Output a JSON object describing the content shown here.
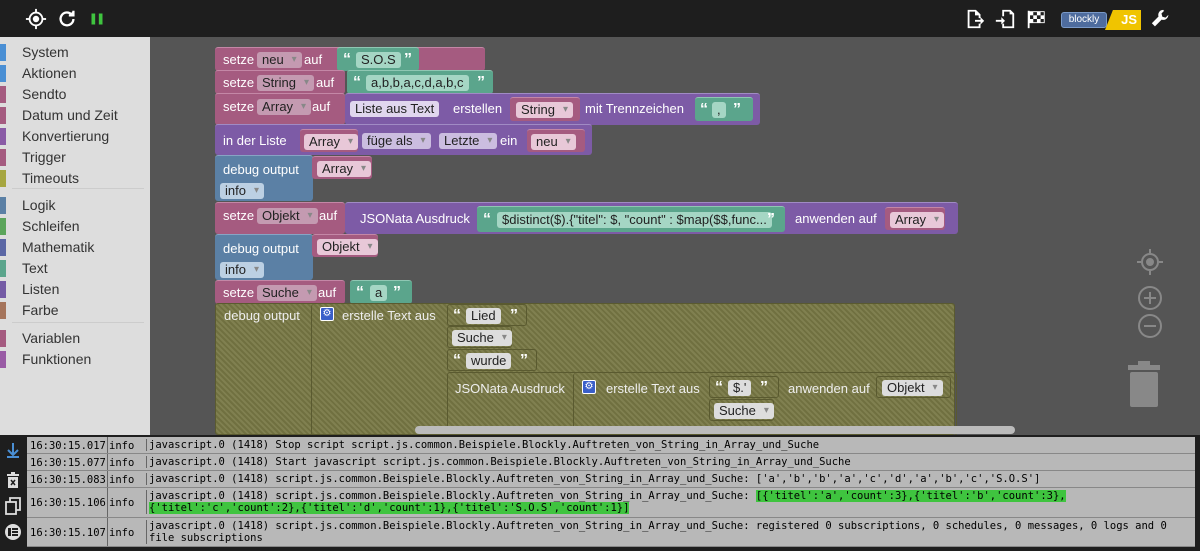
{
  "toolbar": {
    "icons": [
      "target-icon",
      "reload-icon",
      "pause-icon",
      "export-icon",
      "import-icon",
      "flag-icon",
      "wrench-icon"
    ],
    "blockly_label": "blockly",
    "js_label": "JS"
  },
  "toolbox": {
    "categories": [
      {
        "label": "System",
        "color": "#4a8fd4"
      },
      {
        "label": "Aktionen",
        "color": "#4a8fd4"
      },
      {
        "label": "Sendto",
        "color": "#a55b80"
      },
      {
        "label": "Datum und Zeit",
        "color": "#a55b80"
      },
      {
        "label": "Konvertierung",
        "color": "#8a5ba6"
      },
      {
        "label": "Trigger",
        "color": "#a55b80"
      },
      {
        "label": "Timeouts",
        "color": "#a6a640"
      },
      {
        "label": "Logik",
        "color": "#5b80a5"
      },
      {
        "label": "Schleifen",
        "color": "#5ba55b"
      },
      {
        "label": "Mathematik",
        "color": "#5b67a5"
      },
      {
        "label": "Text",
        "color": "#5ba58c"
      },
      {
        "label": "Listen",
        "color": "#745ba5"
      },
      {
        "label": "Farbe",
        "color": "#a5745b"
      },
      {
        "label": "Variablen",
        "color": "#a55b80"
      },
      {
        "label": "Funktionen",
        "color": "#995ba5"
      }
    ]
  },
  "blocks": {
    "setze": "setze",
    "auf": "auf",
    "b1": {
      "var": "neu",
      "text": "S.O.S"
    },
    "b2": {
      "var": "String",
      "text": "a,b,b,a,c,d,a,b,c"
    },
    "b3": {
      "var": "Array",
      "liste": "Liste aus Text",
      "erstellen": "erstellen",
      "src": "String",
      "mit": "mit Trennzeichen",
      "sep": ","
    },
    "b4": {
      "in": "in der Liste",
      "list": "Array",
      "mode": "füge als",
      "pos": "Letzte",
      "ein": "ein",
      "item": "neu"
    },
    "b5": {
      "debug": "debug output",
      "var": "Array",
      "level": "info"
    },
    "b6": {
      "var": "Objekt",
      "jsonata": "JSONata Ausdruck",
      "expr": "$distinct($).{\"titel\": $, \"count\" : $map($$,func...",
      "anwenden": "anwenden auf",
      "target": "Array"
    },
    "b7": {
      "debug": "debug output",
      "var": "Objekt",
      "level": "info"
    },
    "b8": {
      "var": "Suche",
      "text": "a"
    },
    "b9": {
      "debug": "debug output",
      "erstelle": "erstelle Text aus",
      "t1": "Lied",
      "v1": "Suche",
      "t2": "wurde",
      "jsonata": "JSONata Ausdruck",
      "erstelle2": "erstelle Text aus",
      "t3": "$.'",
      "v2": "Suche",
      "anwenden": "anwenden auf",
      "target": "Objekt"
    }
  },
  "log": {
    "rows": [
      {
        "ts": "16:30:15.017",
        "lv": "info",
        "msg": "javascript.0 (1418) Stop script script.js.common.Beispiele.Blockly.Auftreten_von_String_in_Array_und_Suche"
      },
      {
        "ts": "16:30:15.077",
        "lv": "info",
        "msg": "javascript.0 (1418) Start javascript script.js.common.Beispiele.Blockly.Auftreten_von_String_in_Array_und_Suche"
      },
      {
        "ts": "16:30:15.083",
        "lv": "info",
        "msg": "javascript.0 (1418) script.js.common.Beispiele.Blockly.Auftreten_von_String_in_Array_und_Suche: ['a','b','b','a','c','d','a','b','c','S.O.S']"
      },
      {
        "ts": "16:30:15.106",
        "lv": "info",
        "msg": "javascript.0 (1418) script.js.common.Beispiele.Blockly.Auftreten_von_String_in_Array_und_Suche: ",
        "hl": "[{'titel':'a','count':3},{'titel':'b','count':3},{'titel':'c','count':2},{'titel':'d','count':1},{'titel':'S.O.S','count':1}]"
      },
      {
        "ts": "16:30:15.107",
        "lv": "info",
        "msg": "javascript.0 (1418) script.js.common.Beispiele.Blockly.Auftreten_von_String_in_Array_und_Suche: registered 0 subscriptions, 0 schedules, 0 messages, 0 logs and 0 file subscriptions"
      }
    ]
  }
}
